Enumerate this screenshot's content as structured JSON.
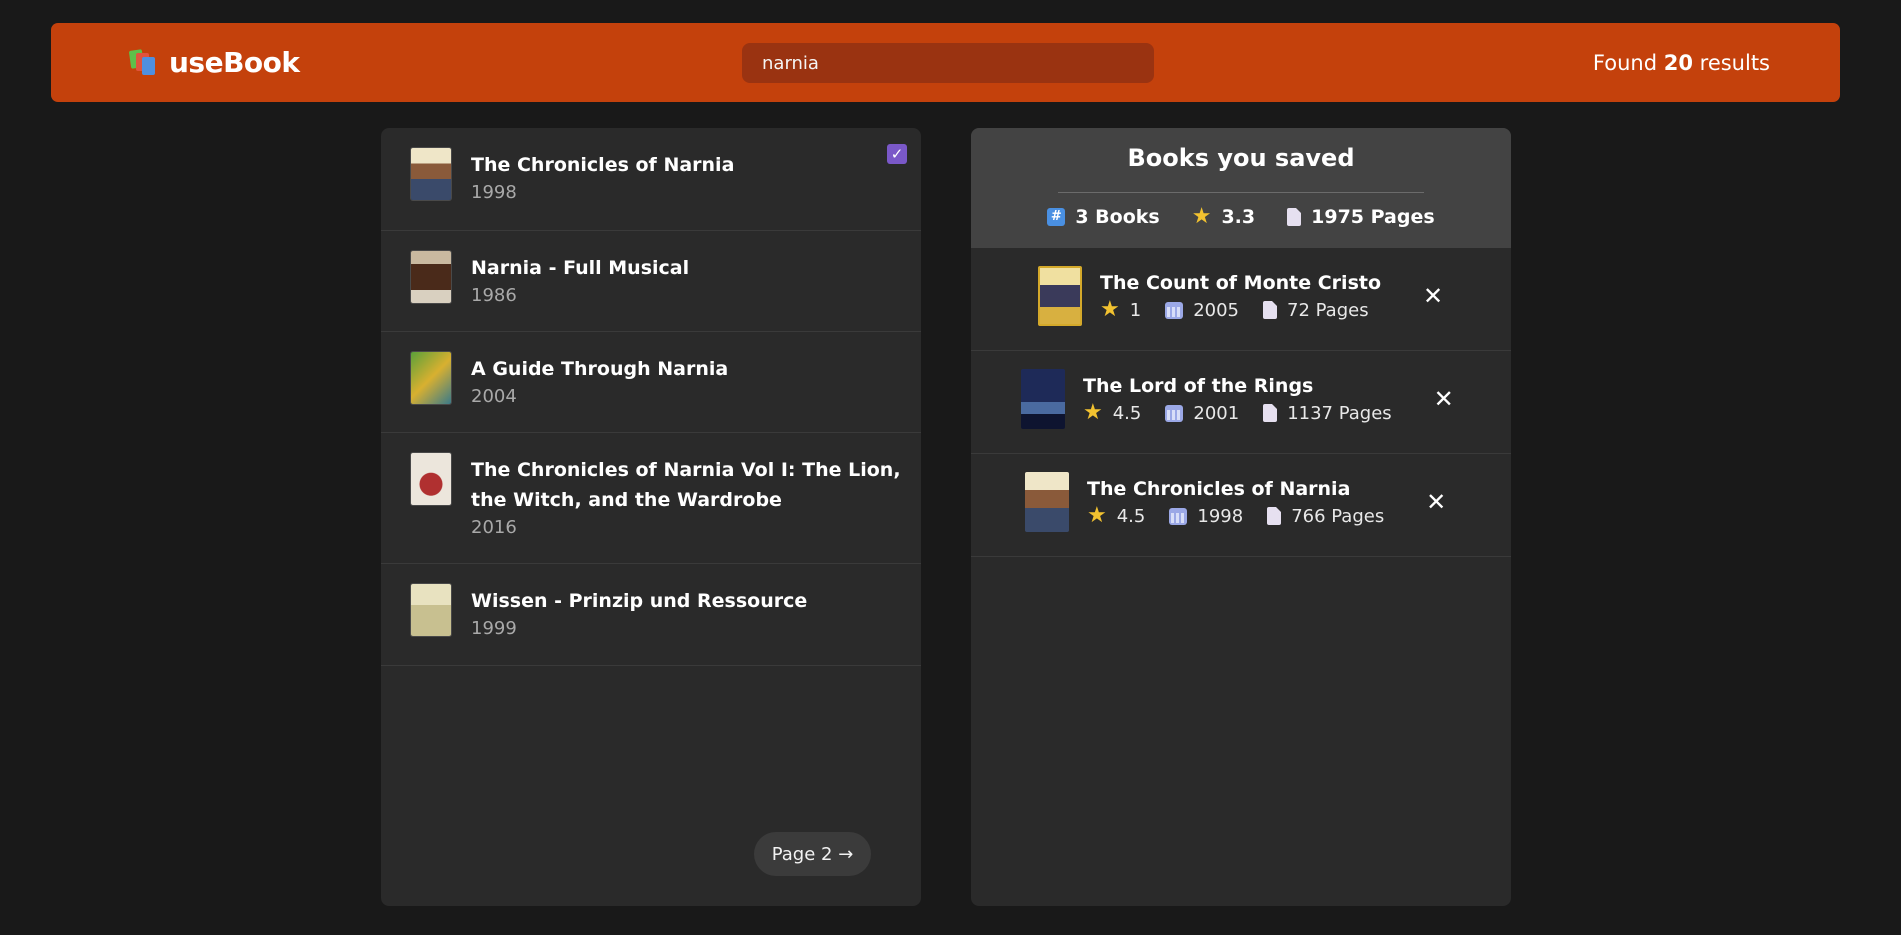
{
  "app": {
    "name": "useBook"
  },
  "search": {
    "value": "narnia",
    "placeholder": "Search books..."
  },
  "results": {
    "prefix": "Found",
    "count": "20",
    "suffix": "results"
  },
  "search_results": [
    {
      "title": "The Chronicles of Narnia",
      "year": "1998",
      "selected": true,
      "cover_color": "#d8cfb0"
    },
    {
      "title": "Narnia - Full Musical",
      "year": "1986",
      "selected": false,
      "cover_color": "#5a3a2a"
    },
    {
      "title": "A Guide Through Narnia",
      "year": "2004",
      "selected": false,
      "cover_color": "#6a9a3a"
    },
    {
      "title": "The Chronicles of Narnia Vol I: The Lion, the Witch, and the Wardrobe",
      "year": "2016",
      "selected": false,
      "cover_color": "#e9e2d6"
    },
    {
      "title": "Wissen - Prinzip und Ressource",
      "year": "1999",
      "selected": false,
      "cover_color": "#e3ddb8"
    }
  ],
  "pagination": {
    "next_label": "Page 2 →"
  },
  "saved": {
    "title": "Books you saved",
    "stats": {
      "books": "3 Books",
      "rating": "3.3",
      "pages": "1975 Pages"
    },
    "items": [
      {
        "title": "The Count of Monte Cristo",
        "rating": "1",
        "year": "2005",
        "pages": "72 Pages",
        "cover_color": "#c9a33a"
      },
      {
        "title": "The Lord of the Rings",
        "rating": "4.5",
        "year": "2001",
        "pages": "1137 Pages",
        "cover_color": "#1e2e5a"
      },
      {
        "title": "The Chronicles of Narnia",
        "rating": "4.5",
        "year": "1998",
        "pages": "766 Pages",
        "cover_color": "#d8cfb0"
      }
    ],
    "remove_label": "✕"
  },
  "icons": {
    "logo": "books-icon",
    "selected": "checkbox-checked-icon",
    "count": "hash-icon",
    "rating": "star-icon",
    "year": "calendar-icon",
    "pages": "page-icon",
    "remove": "close-icon"
  }
}
